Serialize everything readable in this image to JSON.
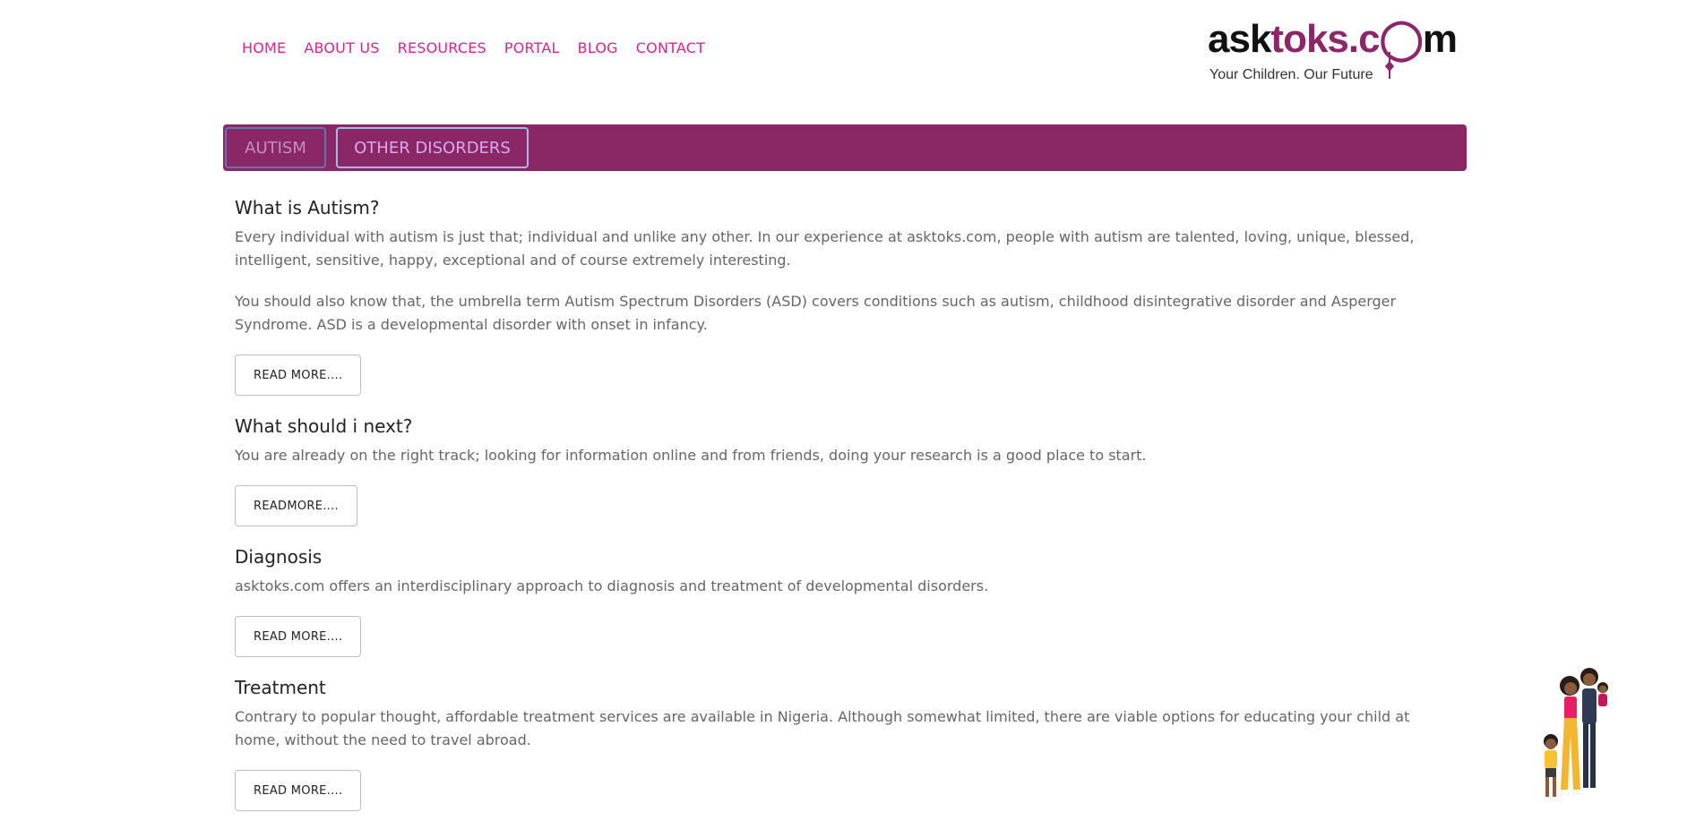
{
  "nav": {
    "items": [
      {
        "label": "HOME"
      },
      {
        "label": "ABOUT US"
      },
      {
        "label": "RESOURCES"
      },
      {
        "label": "PORTAL"
      },
      {
        "label": "BLOG"
      },
      {
        "label": "CONTACT"
      }
    ]
  },
  "logo": {
    "word_part1": "ask",
    "word_part2": "toks.c",
    "word_part3": "m",
    "tagline": "Your Children. Our Future"
  },
  "tabs": [
    {
      "label": "AUTISM"
    },
    {
      "label": "OTHER DISORDERS"
    }
  ],
  "sections": [
    {
      "title": "What is Autism?",
      "paragraphs": [
        "Every individual with autism is just that; individual and unlike any other. In our experience at asktoks.com, people with autism are talented, loving, unique, blessed, intelligent, sensitive, happy, exceptional and of course extremely interesting.",
        "You should also know that, the umbrella term Autism Spectrum Disorders (ASD) covers conditions such as autism, childhood disintegrative disorder and Asperger Syndrome. ASD is a developmental disorder with onset in infancy."
      ],
      "button": "READ MORE...."
    },
    {
      "title": "What should i next?",
      "paragraphs": [
        "You are already on the right track; looking for information online and from friends, doing your research is a good place to start."
      ],
      "button": "READMORE...."
    },
    {
      "title": "Diagnosis",
      "paragraphs": [
        "asktoks.com offers an interdisciplinary approach to diagnosis and treatment of developmental disorders."
      ],
      "button": "READ MORE...."
    },
    {
      "title": "Treatment",
      "paragraphs": [
        "Contrary to popular thought, affordable treatment services are available in Nigeria. Although somewhat limited, there are viable options for educating your child at home, without the need to travel abroad."
      ],
      "button": "READ MORE...."
    }
  ],
  "colors": {
    "accent": "#e0218a",
    "tabbar": "#8a2866",
    "logo_brand": "#8b2668"
  }
}
